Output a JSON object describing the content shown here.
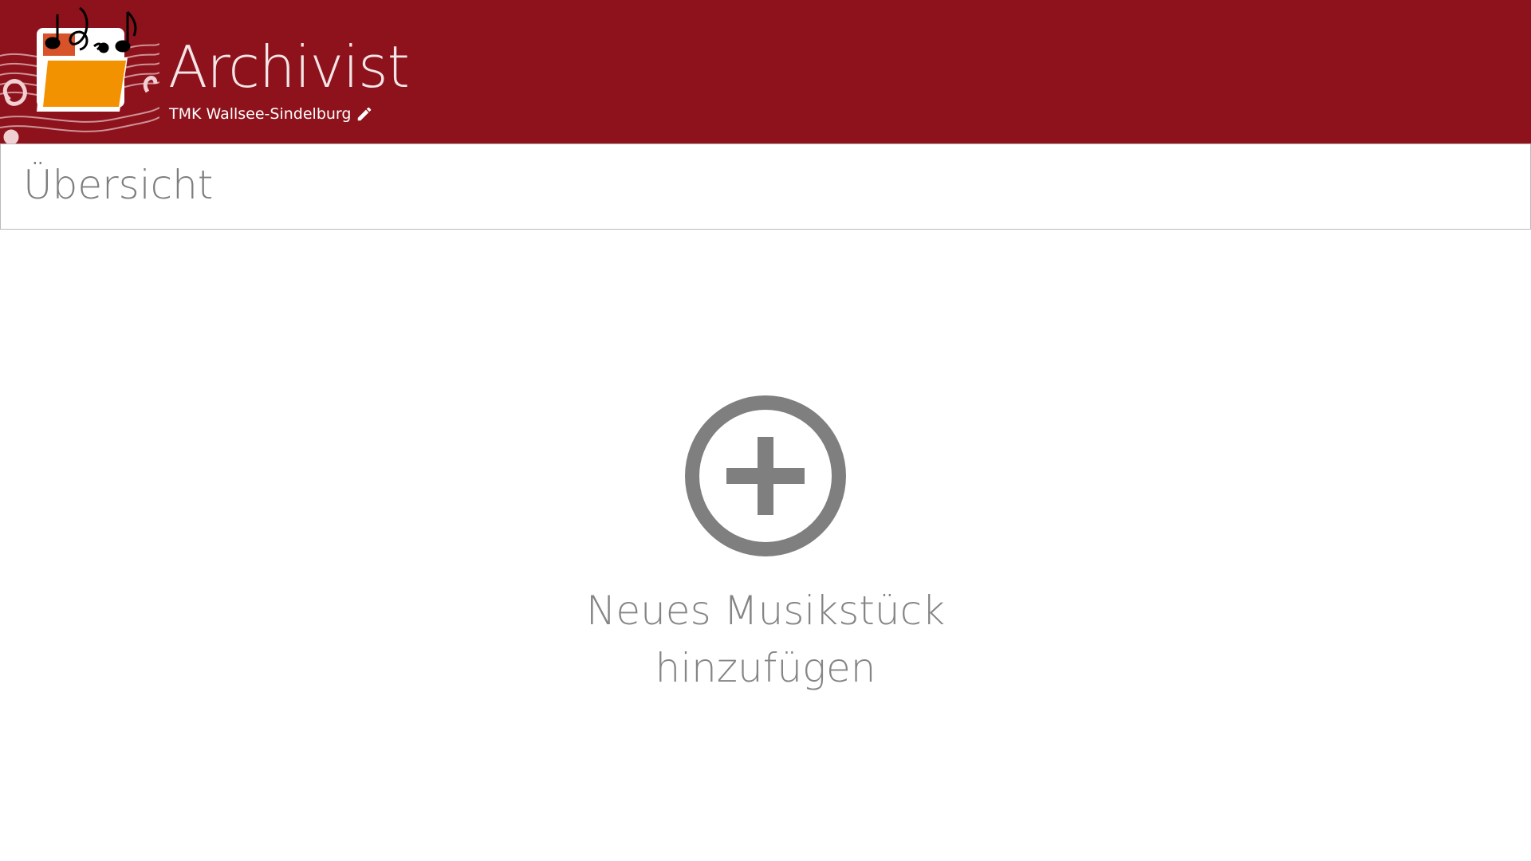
{
  "header": {
    "app_title": "Archivist",
    "organization": "TMK Wallsee-Sindelburg",
    "background_color": "#8e121b",
    "logo_icon": "music-folder-logo",
    "edit_icon": "pencil-icon"
  },
  "page": {
    "title": "Übersicht"
  },
  "main": {
    "add_icon": "plus-circle-icon",
    "add_label_line1": "Neues Musikstück",
    "add_label_line2": "hinzufügen",
    "icon_color": "#7f7f7f"
  }
}
